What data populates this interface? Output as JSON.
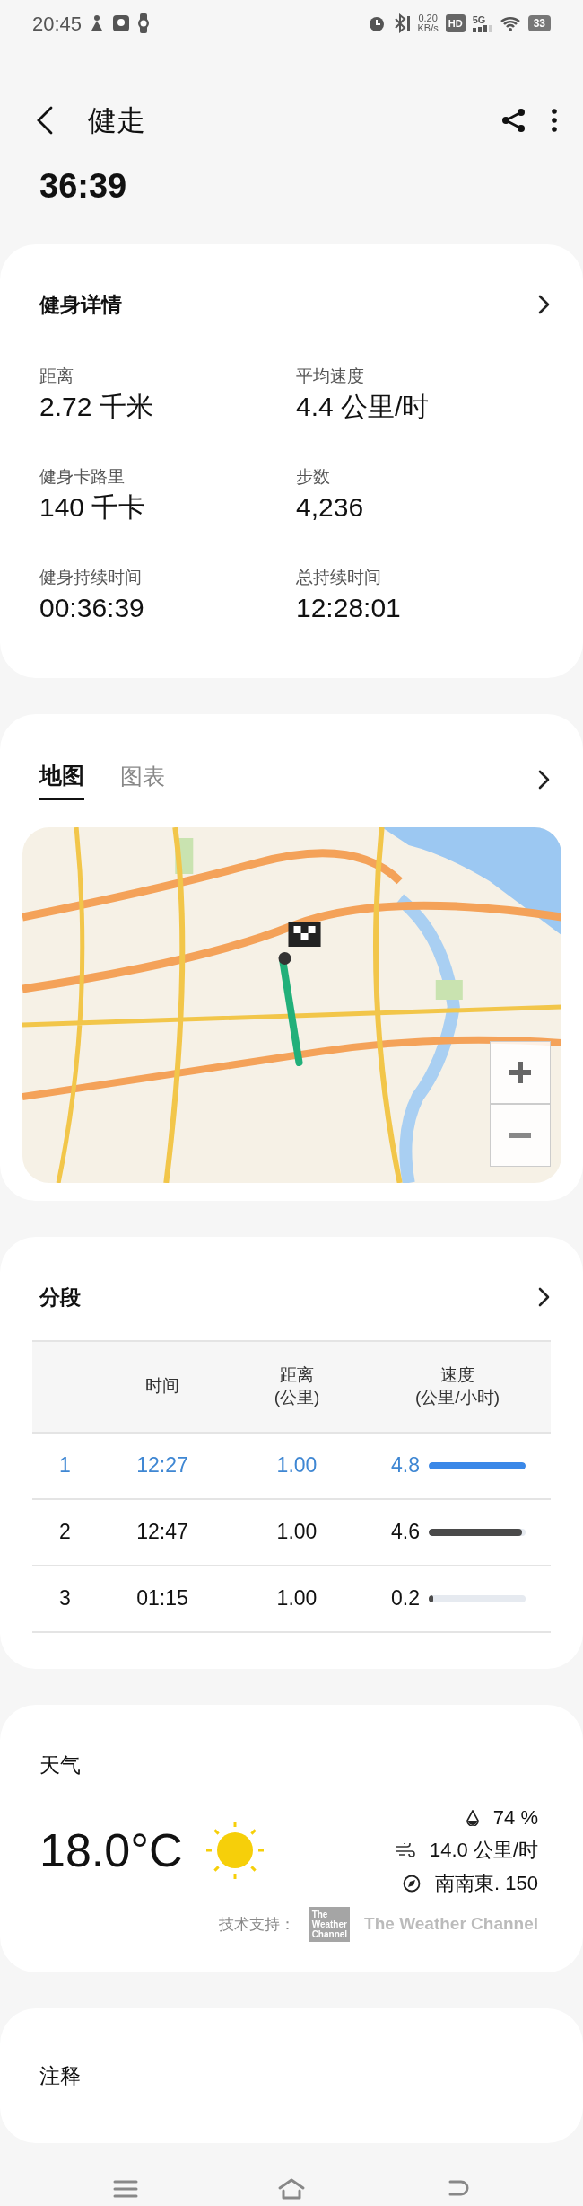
{
  "status_bar": {
    "time": "20:45",
    "net_speed": "0.20",
    "net_speed_unit": "KB/s",
    "hd_badge": "HD",
    "network": "5G",
    "battery": "33"
  },
  "header": {
    "title": "健走",
    "duration": "36:39"
  },
  "details": {
    "title": "健身详情",
    "stats": [
      {
        "label": "距离",
        "value": "2.72 千米"
      },
      {
        "label": "平均速度",
        "value": "4.4 公里/时"
      },
      {
        "label": "健身卡路里",
        "value": "140 千卡"
      },
      {
        "label": "步数",
        "value": "4,236"
      },
      {
        "label": "健身持续时间",
        "value": "00:36:39"
      },
      {
        "label": "总持续时间",
        "value": "12:28:01"
      }
    ]
  },
  "route": {
    "tabs": [
      {
        "label": "地图",
        "selected": true
      },
      {
        "label": "图表",
        "selected": false
      }
    ]
  },
  "splits": {
    "title": "分段",
    "columns": [
      {
        "lines": [
          "时间"
        ]
      },
      {
        "lines": [
          "距离",
          "(公里)"
        ]
      },
      {
        "lines": [
          "速度",
          "(公里/小时)"
        ]
      }
    ],
    "rows": [
      {
        "index": "1",
        "time": "12:27",
        "distance": "1.00",
        "speed": "4.8",
        "level": 1,
        "selected": true
      },
      {
        "index": "2",
        "time": "12:47",
        "distance": "1.00",
        "speed": "4.6",
        "level": 0.96,
        "selected": false
      },
      {
        "index": "3",
        "time": "01:15",
        "distance": "1.00",
        "speed": "0.2",
        "level": 0.05,
        "selected": false
      }
    ]
  },
  "weather": {
    "title": "天气",
    "temperature": "18.0°C",
    "humidity": "74 %",
    "wind_speed": "14.0 公里/时",
    "wind_direction": "南南東. 150",
    "credit_label": "技术支持：",
    "logo_lines": [
      "The",
      "Weather",
      "Channel"
    ],
    "provider": "The Weather Channel"
  },
  "notes": {
    "title": "注释"
  }
}
